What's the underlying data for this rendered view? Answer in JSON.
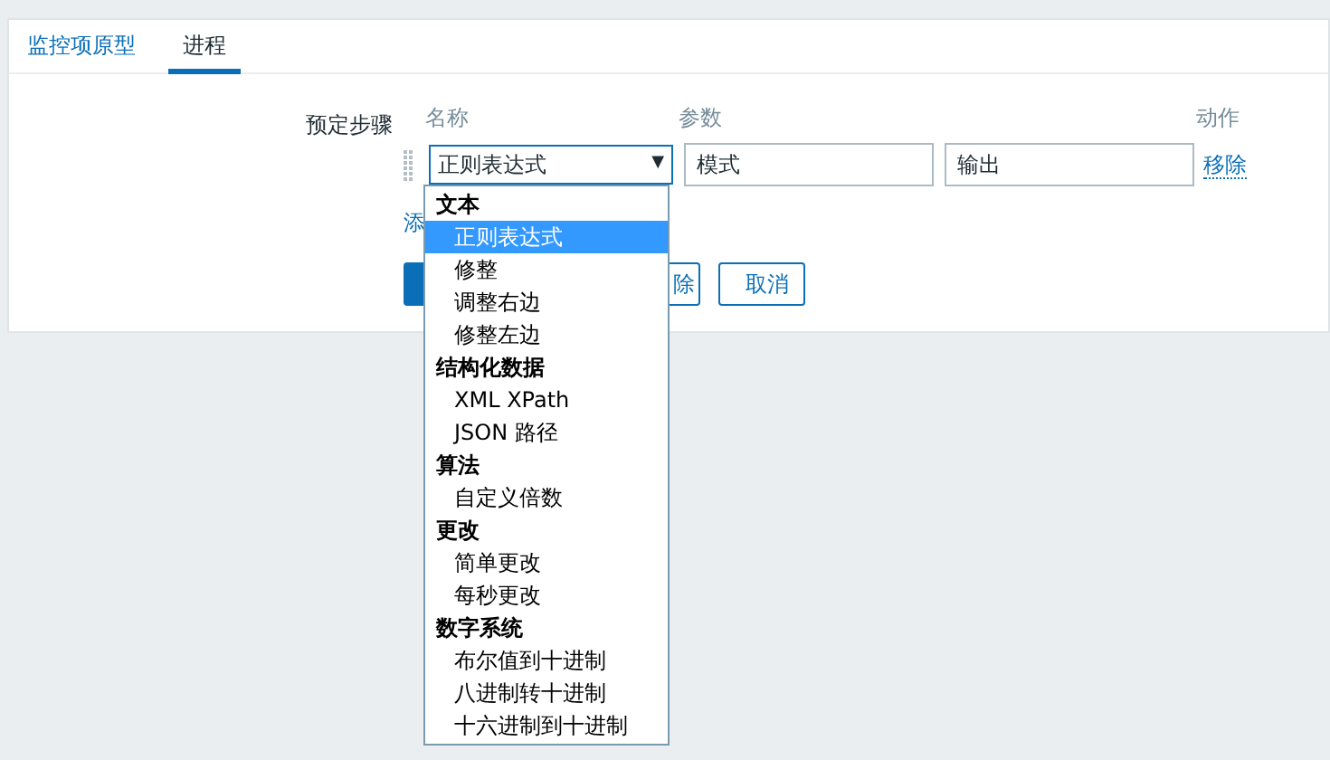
{
  "tabs": [
    {
      "label": "监控项原型",
      "selected": false
    },
    {
      "label": "进程",
      "selected": true
    }
  ],
  "preprocessing": {
    "label": "预定步骤",
    "columns": [
      "名称",
      "参数",
      "动作"
    ],
    "step": {
      "type": "正则表达式",
      "arrow": "▼",
      "params": [
        {
          "placeholder": "模式"
        },
        {
          "placeholder": "输出"
        }
      ],
      "action": "移除"
    },
    "add_link": "添",
    "buttons": [
      {
        "kind": "primary"
      },
      {
        "label": "除",
        "kind": "secondary"
      },
      {
        "label": "取消",
        "kind": "secondary"
      }
    ]
  },
  "dropdown": [
    {
      "group": "文本",
      "options": [
        {
          "label": "正则表达式",
          "selected": true
        },
        {
          "label": "修整",
          "selected": false
        },
        {
          "label": "调整右边",
          "selected": false
        },
        {
          "label": "修整左边",
          "selected": false
        }
      ]
    },
    {
      "group": "结构化数据",
      "options": [
        {
          "label": "XML XPath",
          "selected": false
        },
        {
          "label": "JSON 路径",
          "selected": false
        }
      ]
    },
    {
      "group": "算法",
      "options": [
        {
          "label": "自定义倍数",
          "selected": false
        }
      ]
    },
    {
      "group": "更改",
      "options": [
        {
          "label": "简单更改",
          "selected": false
        },
        {
          "label": "每秒更改",
          "selected": false
        }
      ]
    },
    {
      "group": "数字系统",
      "options": [
        {
          "label": "布尔值到十进制",
          "selected": false
        },
        {
          "label": "八进制转十进制",
          "selected": false
        },
        {
          "label": "十六进制到十进制",
          "selected": false
        }
      ]
    }
  ]
}
